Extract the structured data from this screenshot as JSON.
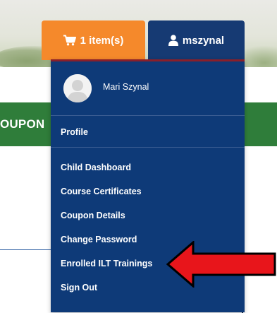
{
  "header": {
    "cart_label": "1 item(s)",
    "cart_icon": "shopping-cart-icon",
    "user_label": "mszynal",
    "user_icon": "user-icon"
  },
  "banner": {
    "coupon_text": "OUPON"
  },
  "dropdown": {
    "user_name": "Mari Szynal",
    "avatar_icon": "default-avatar-icon",
    "items": [
      {
        "label": "Profile"
      },
      {
        "label": "Child Dashboard"
      },
      {
        "label": "Course Certificates"
      },
      {
        "label": "Coupon Details"
      },
      {
        "label": "Change Password"
      },
      {
        "label": "Enrolled ILT Trainings"
      },
      {
        "label": "Sign Out"
      }
    ]
  },
  "annotation": {
    "arrow_color": "#e8151b",
    "arrow_outline": "#000000",
    "arrow_icon": "red-pointer-arrow"
  },
  "colors": {
    "cart_orange": "#f5892b",
    "user_navy": "#163a73",
    "menu_navy": "#0e3a78",
    "banner_green": "#2f7d3a"
  }
}
